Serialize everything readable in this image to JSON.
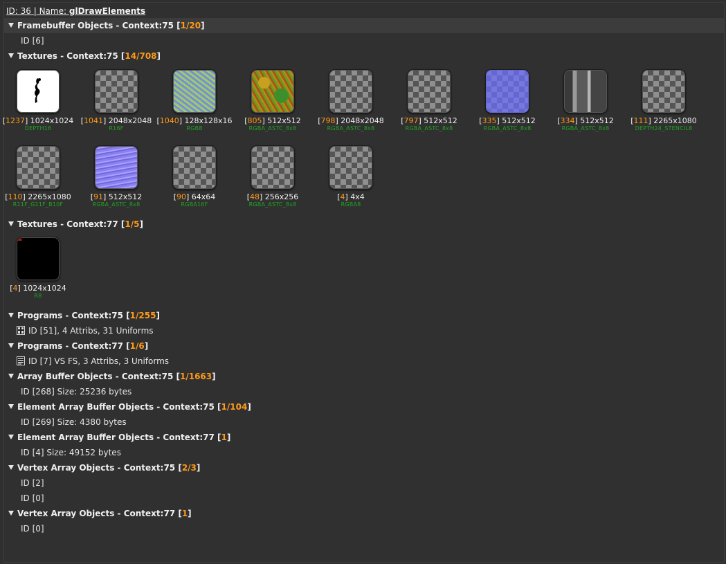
{
  "header": {
    "id_label": "ID: 36 | Name:",
    "name": "glDrawElements"
  },
  "sections": {
    "fbo": {
      "title": "Framebuffer Objects - Context:75 [",
      "count": "1/20",
      "close": "]",
      "items": [
        "ID [6]"
      ]
    },
    "tex75": {
      "title": "Textures - Context:75 [",
      "count": "14/708",
      "close": "]",
      "textures": [
        {
          "id": "1237",
          "size": "1024x1024",
          "format": "DEPTH16",
          "preview": "white-figure"
        },
        {
          "id": "1041",
          "size": "2048x2048",
          "format": "R16F",
          "preview": "checker"
        },
        {
          "id": "1040",
          "size": "128x128x16",
          "format": "RGB8",
          "preview": "noise"
        },
        {
          "id": "805",
          "size": "512x512",
          "format": "RGBA_ASTC_8x8",
          "preview": "terrain"
        },
        {
          "id": "798",
          "size": "2048x2048",
          "format": "RGBA_ASTC_8x8",
          "preview": "checker"
        },
        {
          "id": "797",
          "size": "512x512",
          "format": "RGBA_ASTC_8x8",
          "preview": "checker"
        },
        {
          "id": "335",
          "size": "512x512",
          "format": "RGBA_ASTC_8x8",
          "preview": "blue-checker"
        },
        {
          "id": "334",
          "size": "512x512",
          "format": "RGBA_ASTC_8x8",
          "preview": "gray-mech"
        },
        {
          "id": "111",
          "size": "2265x1080",
          "format": "DEPTH24_STENCIL8",
          "preview": "checker"
        },
        {
          "id": "110",
          "size": "2265x1080",
          "format": "R11F_G11F_B10F",
          "preview": "checker"
        },
        {
          "id": "91",
          "size": "512x512",
          "format": "RGBA_ASTC_8x8",
          "preview": "normal"
        },
        {
          "id": "90",
          "size": "64x64",
          "format": "RGBA16F",
          "preview": "checker"
        },
        {
          "id": "48",
          "size": "256x256",
          "format": "RGBA_ASTC_8x8",
          "preview": "checker"
        },
        {
          "id": "4",
          "size": "4x4",
          "format": "RGBA8",
          "preview": "checker"
        }
      ]
    },
    "tex77": {
      "title": "Textures - Context:77 [",
      "count": "1/5",
      "close": "]",
      "textures": [
        {
          "id": "4",
          "size": "1024x1024",
          "format": "R8",
          "preview": "black"
        }
      ]
    },
    "prog75": {
      "title": "Programs - Context:75 [",
      "count": "1/255",
      "close": "]",
      "items": [
        "ID [51], 4 Attribs, 31 Uniforms"
      ]
    },
    "prog77": {
      "title": "Programs - Context:77 [",
      "count": "1/6",
      "close": "]",
      "items": [
        "ID [7] VS FS, 3 Attribs, 3 Uniforms"
      ]
    },
    "abo75": {
      "title": "Array Buffer Objects - Context:75 [",
      "count": "1/1663",
      "close": "]",
      "items": [
        "ID [268] Size: 25236 bytes"
      ]
    },
    "eabo75": {
      "title": "Element Array Buffer Objects - Context:75 [",
      "count": "1/104",
      "close": "]",
      "items": [
        "ID [269] Size: 4380 bytes"
      ]
    },
    "eabo77": {
      "title": "Element Array Buffer Objects - Context:77 [",
      "count": "1",
      "close": "]",
      "items": [
        "ID [4] Size: 49152 bytes"
      ]
    },
    "vao75": {
      "title": "Vertex Array Objects - Context:75 [",
      "count": "2/3",
      "close": "]",
      "items": [
        "ID [2]",
        "ID [0]"
      ]
    },
    "vao77": {
      "title": "Vertex Array Objects - Context:77 [",
      "count": "1",
      "close": "]",
      "items": [
        "ID [0]"
      ]
    }
  },
  "colors": {
    "accent": "#ff9a1a",
    "format_text": "#1fa51f",
    "background": "#2f2f2f"
  },
  "icons": {
    "section_toggle": "triangle-down-icon",
    "program_75": "program-grid-icon",
    "program_77": "program-list-icon"
  }
}
